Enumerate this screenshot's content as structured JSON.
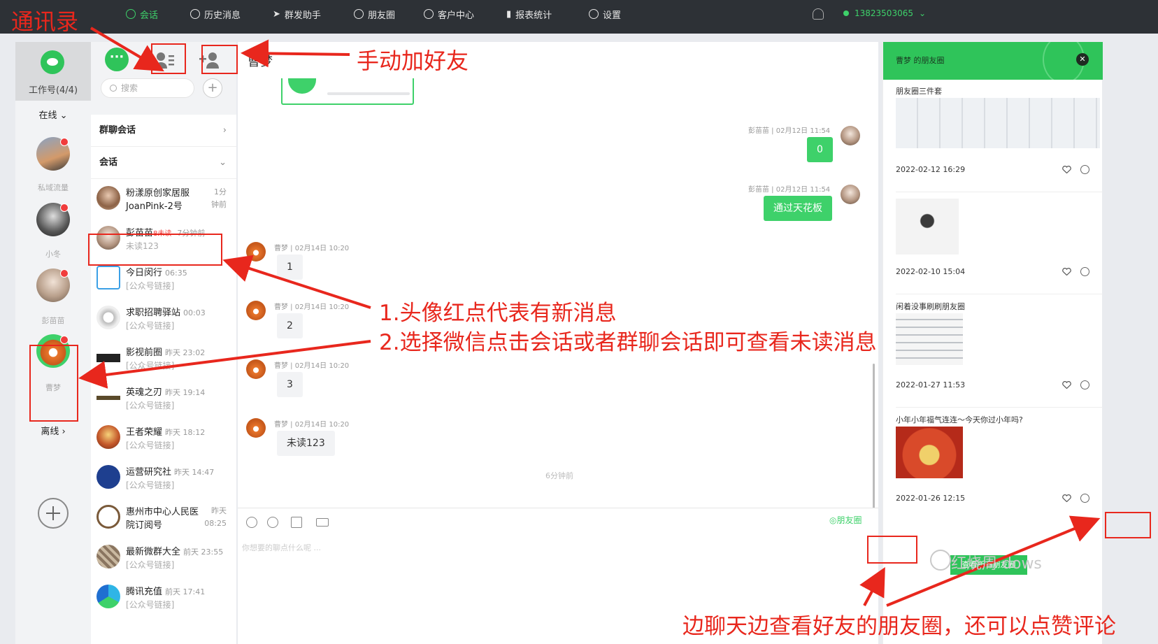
{
  "topbar": {
    "nav": [
      {
        "label": "会话",
        "icon": "chat-icon",
        "active": true
      },
      {
        "label": "历史消息",
        "icon": "clock-icon"
      },
      {
        "label": "群发助手",
        "icon": "send-icon"
      },
      {
        "label": "朋友圈",
        "icon": "aperture-icon"
      },
      {
        "label": "客户中心",
        "icon": "user-icon"
      },
      {
        "label": "报表统计",
        "icon": "bar-chart-icon"
      },
      {
        "label": "设置",
        "icon": "gear-icon"
      }
    ],
    "phone": "13823503065"
  },
  "accounts": {
    "header_label": "工作号(4/4)",
    "online_label": "在线 ⌄",
    "offline_label": "离线 ›",
    "items": [
      {
        "name": "私域流量",
        "unread": true
      },
      {
        "name": "小冬",
        "unread": true
      },
      {
        "name": "彭苗苗",
        "unread": true
      },
      {
        "name": "曹梦",
        "unread": true
      }
    ]
  },
  "conversation_list": {
    "search_placeholder": "搜索",
    "group_chats_label": "群聊会话",
    "chats_label": "会话",
    "items": [
      {
        "name": "粉漾原创家居服JoanPink-2号",
        "line1": "粉漾原创家居服",
        "line2": "JoanPink-2号",
        "time_a": "1分",
        "time_b": "钟前"
      },
      {
        "name": "彭苗苗",
        "unread": "8未读",
        "time": "7分钟前",
        "preview": "未读123"
      },
      {
        "name": "今日闵行",
        "time": "06:35",
        "preview": "[公众号链接]"
      },
      {
        "name": "求职招聘驿站",
        "time": "00:03",
        "preview": "[公众号链接]"
      },
      {
        "name": "影视前圈",
        "time": "昨天 23:02",
        "preview": "[公众号链接]"
      },
      {
        "name": "英魂之刃",
        "time": "昨天 19:14",
        "preview": "[公众号链接]"
      },
      {
        "name": "王者荣耀",
        "time": "昨天 18:12",
        "preview": "[公众号链接]"
      },
      {
        "name": "运营研究社",
        "time": "昨天 14:47",
        "preview": "[公众号链接]"
      },
      {
        "name": "惠州市中心人民医院订阅号",
        "line1": "惠州市中心人民医",
        "line2": "院订阅号",
        "time_a": "昨天",
        "time_b": "08:25"
      },
      {
        "name": "最新微群大全",
        "time": "前天 23:55",
        "preview": "[公众号链接]"
      },
      {
        "name": "腾讯充值",
        "time": "前天 17:41",
        "preview": "[公众号链接]"
      }
    ]
  },
  "chat": {
    "title": "曹梦",
    "messages": [
      {
        "dir": "out",
        "meta": "彭苗苗 | 02月12日 11:54",
        "text": "0"
      },
      {
        "dir": "out",
        "meta": "彭苗苗 | 02月12日 11:54",
        "text": "通过天花板"
      },
      {
        "dir": "in",
        "meta": "曹梦 | 02月14日 10:20",
        "text": "1"
      },
      {
        "dir": "in",
        "meta": "曹梦 | 02月14日 10:20",
        "text": "2"
      },
      {
        "dir": "in",
        "meta": "曹梦 | 02月14日 10:20",
        "text": "3"
      },
      {
        "dir": "in",
        "meta": "曹梦 | 02月14日 10:20",
        "text": "未读123"
      }
    ],
    "ago": "6分钟前",
    "moments_button": "◎朋友圈",
    "input_placeholder": "你想要的聊点什么呢 ..."
  },
  "moments": {
    "title": "曹梦 的朋友圈",
    "posts": [
      {
        "caption": "朋友圈三件套",
        "date": "2022-02-12 16:29"
      },
      {
        "caption": "",
        "date": "2022-02-10 15:04"
      },
      {
        "caption": "闲着没事刷刷朋友圈",
        "date": "2022-01-27 11:53"
      },
      {
        "caption": "小年小年福气连连～今天你过小年吗?",
        "date": "2022-01-26 12:15"
      }
    ],
    "view_all": "查看所有朋友圈"
  },
  "annotations": {
    "contacts": "通讯录",
    "add_friend": "手动加好友",
    "red_dot_1": "1.头像红点代表有新消息",
    "red_dot_2": "2.选择微信点击会话或者群聊会话即可查看未读消息",
    "moments_tip": "边聊天边查看好友的朋友圈，还可以点赞评论"
  },
  "watermark": {
    "brand": "红烧周",
    "windows_text": "dows"
  },
  "colors": {
    "accent_green": "#3ed16a",
    "annotation_red": "#e8271d",
    "topbar": "#2d3136"
  }
}
